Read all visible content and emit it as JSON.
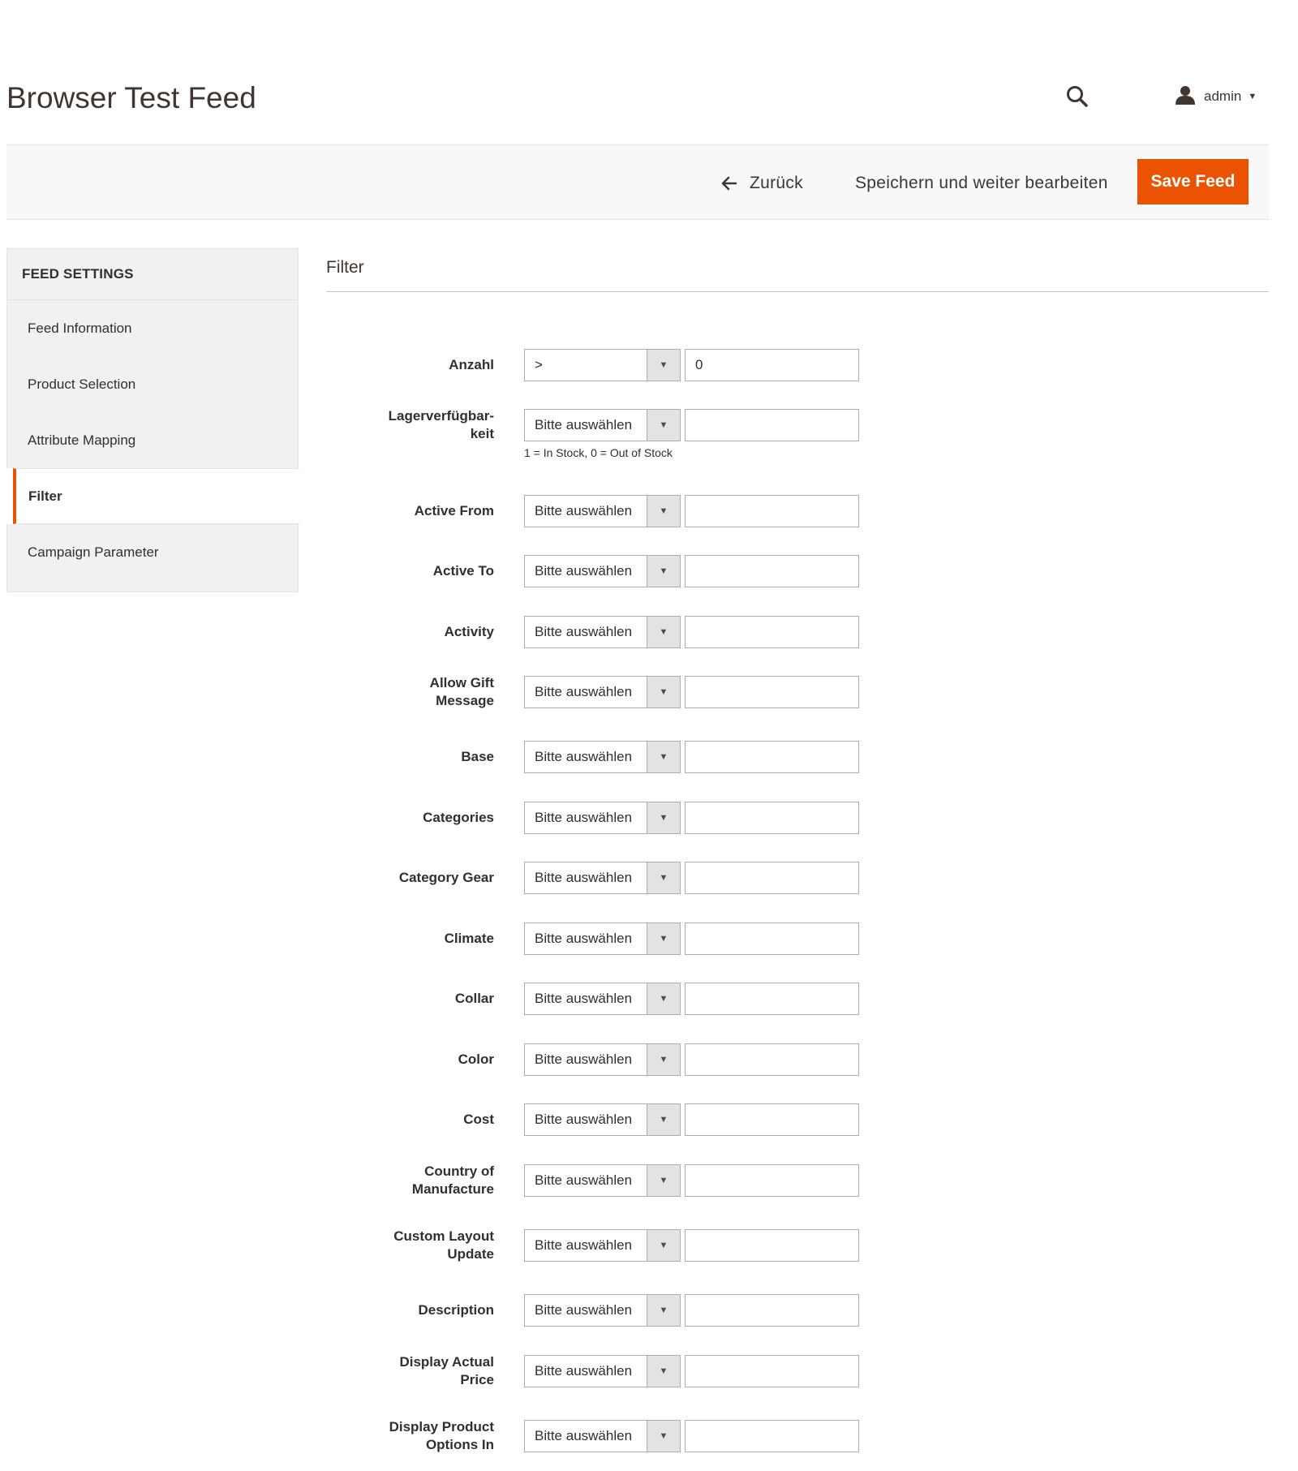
{
  "header": {
    "title": "Browser Test Feed",
    "search_icon": "search-icon",
    "user": {
      "name": "admin",
      "icon": "user-icon"
    }
  },
  "actions": {
    "back_label": "Zurück",
    "save_continue_label": "Speichern und weiter bearbeiten",
    "save_label": "Save Feed"
  },
  "sidebar": {
    "title": "FEED SETTINGS",
    "items": [
      {
        "label": "Feed Information"
      },
      {
        "label": "Product Selection"
      },
      {
        "label": "Attribute Mapping"
      },
      {
        "label": "Filter",
        "active": true
      },
      {
        "label": "Campaign Parameter"
      }
    ]
  },
  "section": {
    "title": "Filter"
  },
  "filters": [
    {
      "label": "Anzahl",
      "operator": ">",
      "value": "0"
    },
    {
      "label": "Lagerverfügbar-\nkeit",
      "operator": "Bitte auswählen",
      "value": "",
      "note": "1 = In Stock, 0 = Out of Stock"
    },
    {
      "label": "Active From",
      "operator": "Bitte auswählen",
      "value": ""
    },
    {
      "label": "Active To",
      "operator": "Bitte auswählen",
      "value": ""
    },
    {
      "label": "Activity",
      "operator": "Bitte auswählen",
      "value": ""
    },
    {
      "label": "Allow Gift\nMessage",
      "operator": "Bitte auswählen",
      "value": ""
    },
    {
      "label": "Base",
      "operator": "Bitte auswählen",
      "value": ""
    },
    {
      "label": "Categories",
      "operator": "Bitte auswählen",
      "value": ""
    },
    {
      "label": "Category Gear",
      "operator": "Bitte auswählen",
      "value": ""
    },
    {
      "label": "Climate",
      "operator": "Bitte auswählen",
      "value": ""
    },
    {
      "label": "Collar",
      "operator": "Bitte auswählen",
      "value": ""
    },
    {
      "label": "Color",
      "operator": "Bitte auswählen",
      "value": ""
    },
    {
      "label": "Cost",
      "operator": "Bitte auswählen",
      "value": ""
    },
    {
      "label": "Country of\nManufacture",
      "operator": "Bitte auswählen",
      "value": ""
    },
    {
      "label": "Custom Layout\nUpdate",
      "operator": "Bitte auswählen",
      "value": ""
    },
    {
      "label": "Description",
      "operator": "Bitte auswählen",
      "value": ""
    },
    {
      "label": "Display Actual\nPrice",
      "operator": "Bitte auswählen",
      "value": ""
    },
    {
      "label": "Display Product\nOptions In",
      "operator": "Bitte auswählen",
      "value": ""
    }
  ],
  "colors": {
    "accent": "#eb5202",
    "text": "#41362f",
    "bar_bg": "#f8f8f8",
    "sidebar_bg": "#f1f1f1"
  }
}
